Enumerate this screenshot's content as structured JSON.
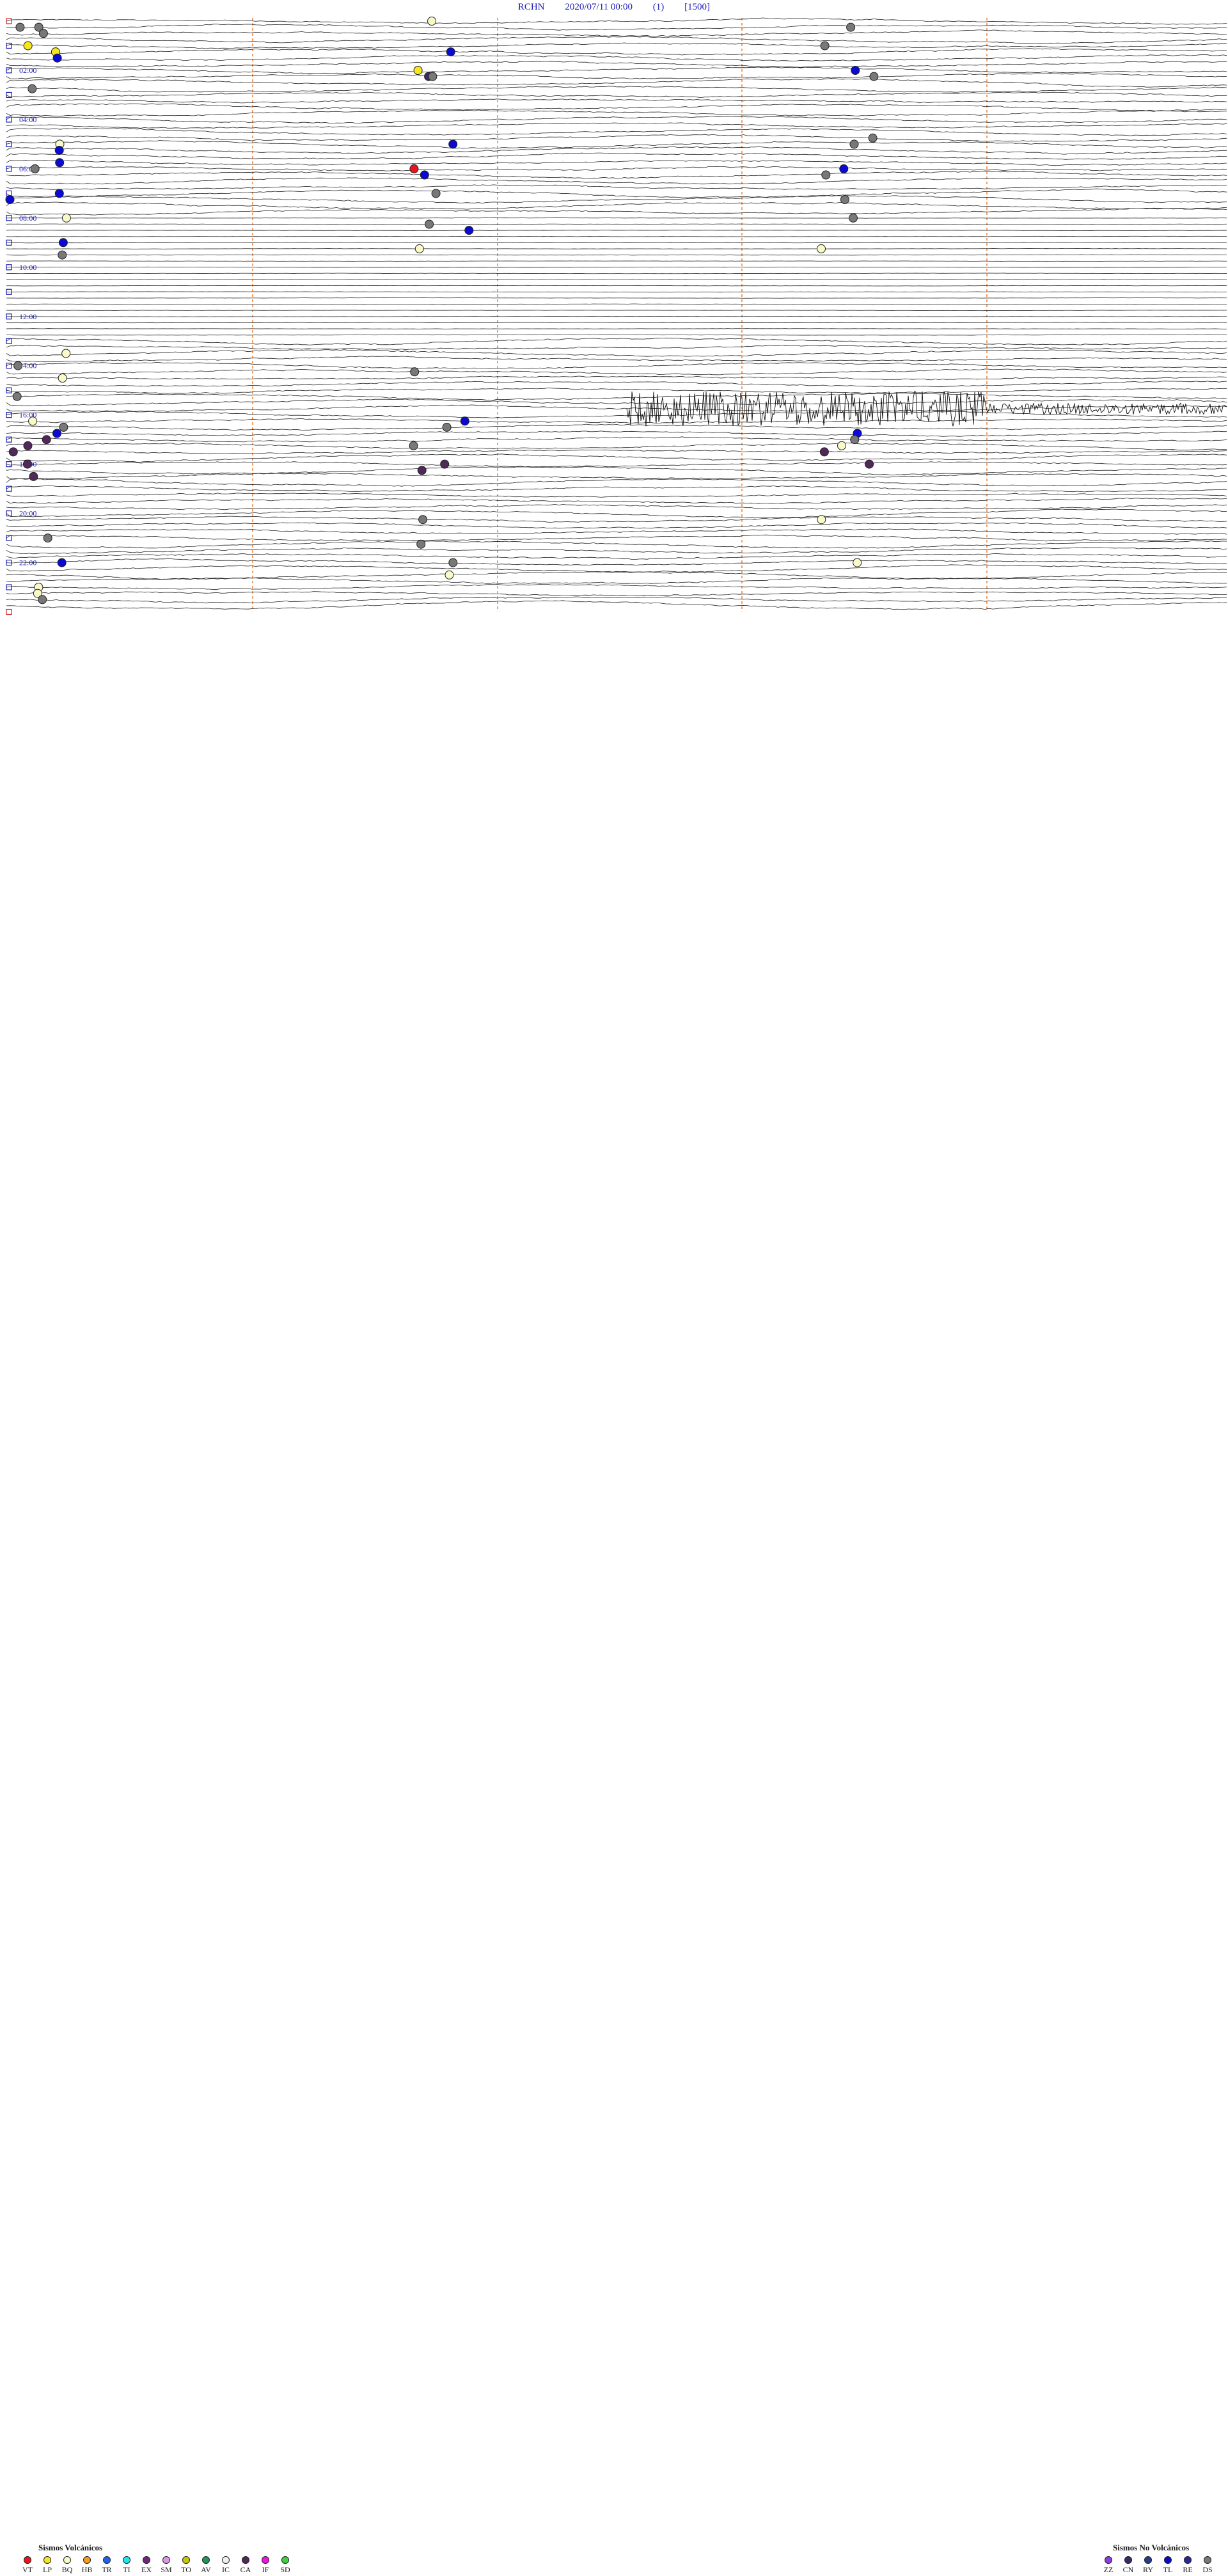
{
  "header": {
    "station": "RCHN",
    "datetime": "2020/07/11 00:00",
    "channel": "(1)",
    "scale": "[1500]"
  },
  "chart_data": {
    "type": "helicorder",
    "start": "2020/07/11 00:00",
    "hours": 24,
    "lines_per_hour": 4,
    "hour_labels": [
      {
        "hour": 2,
        "label": "02:00"
      },
      {
        "hour": 4,
        "label": "04:00"
      },
      {
        "hour": 6,
        "label": "06:00"
      },
      {
        "hour": 8,
        "label": "08:00"
      },
      {
        "hour": 10,
        "label": "10:00"
      },
      {
        "hour": 12,
        "label": "12:00"
      },
      {
        "hour": 14,
        "label": "14:00"
      },
      {
        "hour": 16,
        "label": "16:00"
      },
      {
        "hour": 18,
        "label": "18:00"
      },
      {
        "hour": 20,
        "label": "20:00"
      },
      {
        "hour": 22,
        "label": "22:00"
      }
    ],
    "flat_hours": [
      8,
      9,
      10,
      11,
      12
    ],
    "noise_burst": {
      "start_hour": 15.75,
      "label": ""
    },
    "events": [
      {
        "t": "00:05",
        "type": "BQ"
      },
      {
        "t": "00:15",
        "type": "DS"
      },
      {
        "t": "00:15",
        "type": "DS"
      },
      {
        "t": "00:25",
        "type": "DS"
      },
      {
        "t": "00:30",
        "type": "DS"
      },
      {
        "t": "01:00",
        "type": "LP"
      },
      {
        "t": "01:10",
        "type": "DS"
      },
      {
        "t": "01:15",
        "type": "LP"
      },
      {
        "t": "01:20",
        "type": "TL"
      },
      {
        "t": "01:30",
        "type": "TL"
      },
      {
        "t": "02:05",
        "type": "LP"
      },
      {
        "t": "02:10",
        "type": "TL"
      },
      {
        "t": "02:20",
        "type": "CN"
      },
      {
        "t": "02:20",
        "type": "DS"
      },
      {
        "t": "02:25",
        "type": "DS"
      },
      {
        "t": "02:45",
        "type": "DS"
      },
      {
        "t": "04:55",
        "type": "DS"
      },
      {
        "t": "05:00",
        "type": "BQ"
      },
      {
        "t": "05:05",
        "type": "TL"
      },
      {
        "t": "05:10",
        "type": "DS"
      },
      {
        "t": "05:15",
        "type": "TL"
      },
      {
        "t": "05:45",
        "type": "TL"
      },
      {
        "t": "06:00",
        "type": "DS"
      },
      {
        "t": "06:05",
        "type": "VT"
      },
      {
        "t": "06:10",
        "type": "TL"
      },
      {
        "t": "06:20",
        "type": "TL"
      },
      {
        "t": "06:25",
        "type": "DS"
      },
      {
        "t": "07:00",
        "type": "TL"
      },
      {
        "t": "07:05",
        "type": "DS"
      },
      {
        "t": "07:15",
        "type": "TL"
      },
      {
        "t": "07:25",
        "type": "DS"
      },
      {
        "t": "08:00",
        "type": "BQ"
      },
      {
        "t": "08:10",
        "type": "DS"
      },
      {
        "t": "08:20",
        "type": "DS"
      },
      {
        "t": "08:35",
        "type": "TL"
      },
      {
        "t": "09:00",
        "type": "TL"
      },
      {
        "t": "09:20",
        "type": "BQ"
      },
      {
        "t": "09:25",
        "type": "BQ"
      },
      {
        "t": "09:30",
        "type": "DS"
      },
      {
        "t": "13:30",
        "type": "BQ"
      },
      {
        "t": "14:00",
        "type": "DS"
      },
      {
        "t": "14:20",
        "type": "DS"
      },
      {
        "t": "14:30",
        "type": "BQ"
      },
      {
        "t": "15:15",
        "type": "DS"
      },
      {
        "t": "16:15",
        "type": "BQ"
      },
      {
        "t": "16:20",
        "type": "TL"
      },
      {
        "t": "16:30",
        "type": "DS"
      },
      {
        "t": "16:35",
        "type": "DS"
      },
      {
        "t": "16:45",
        "type": "TL"
      },
      {
        "t": "16:55",
        "type": "TL"
      },
      {
        "t": "17:00",
        "type": "CA"
      },
      {
        "t": "17:10",
        "type": "DS"
      },
      {
        "t": "17:15",
        "type": "CA"
      },
      {
        "t": "17:20",
        "type": "DS"
      },
      {
        "t": "17:25",
        "type": "BQ"
      },
      {
        "t": "17:30",
        "type": "CA"
      },
      {
        "t": "17:40",
        "type": "CA"
      },
      {
        "t": "18:00",
        "type": "CA"
      },
      {
        "t": "18:05",
        "type": "CA"
      },
      {
        "t": "18:10",
        "type": "CA"
      },
      {
        "t": "18:20",
        "type": "CA"
      },
      {
        "t": "18:30",
        "type": "CA"
      },
      {
        "t": "20:20",
        "type": "DS"
      },
      {
        "t": "20:25",
        "type": "BQ"
      },
      {
        "t": "21:00",
        "type": "DS"
      },
      {
        "t": "21:20",
        "type": "DS"
      },
      {
        "t": "22:00",
        "type": "TL"
      },
      {
        "t": "22:05",
        "type": "DS"
      },
      {
        "t": "22:10",
        "type": "BQ"
      },
      {
        "t": "22:35",
        "type": "BQ"
      },
      {
        "t": "23:00",
        "type": "BQ"
      },
      {
        "t": "23:15",
        "type": "BQ"
      },
      {
        "t": "23:30",
        "type": "DS"
      }
    ]
  },
  "legend": {
    "volcanic_title": "Sismos Volcánicos",
    "volcanic": [
      {
        "code": "VT",
        "color": "#e8141e"
      },
      {
        "code": "LP",
        "color": "#f5e61e"
      },
      {
        "code": "BQ",
        "color": "#fafac8"
      },
      {
        "code": "HB",
        "color": "#f59b1e"
      },
      {
        "code": "TR",
        "color": "#1e64f0"
      },
      {
        "code": "TI",
        "color": "#1ee6f0"
      },
      {
        "code": "EX",
        "color": "#6e2878"
      },
      {
        "code": "SM",
        "color": "#dc96e6"
      },
      {
        "code": "TO",
        "color": "#c8c800"
      },
      {
        "code": "AV",
        "color": "#1e965a"
      },
      {
        "code": "IC",
        "color": "#f0f0f0"
      },
      {
        "code": "CA",
        "color": "#50285a"
      },
      {
        "code": "IF",
        "color": "#f014dc"
      },
      {
        "code": "SD",
        "color": "#3cd23c"
      }
    ],
    "nonvolcanic_title": "Sismos No Volcánicos",
    "nonvolcanic": [
      {
        "code": "ZZ",
        "color": "#8c3cdc"
      },
      {
        "code": "CN",
        "color": "#3c2864"
      },
      {
        "code": "RY",
        "color": "#283c8c"
      },
      {
        "code": "TL",
        "color": "#0a0ad2"
      },
      {
        "code": "RE",
        "color": "#28289b"
      },
      {
        "code": "DS",
        "color": "#787878"
      }
    ]
  }
}
